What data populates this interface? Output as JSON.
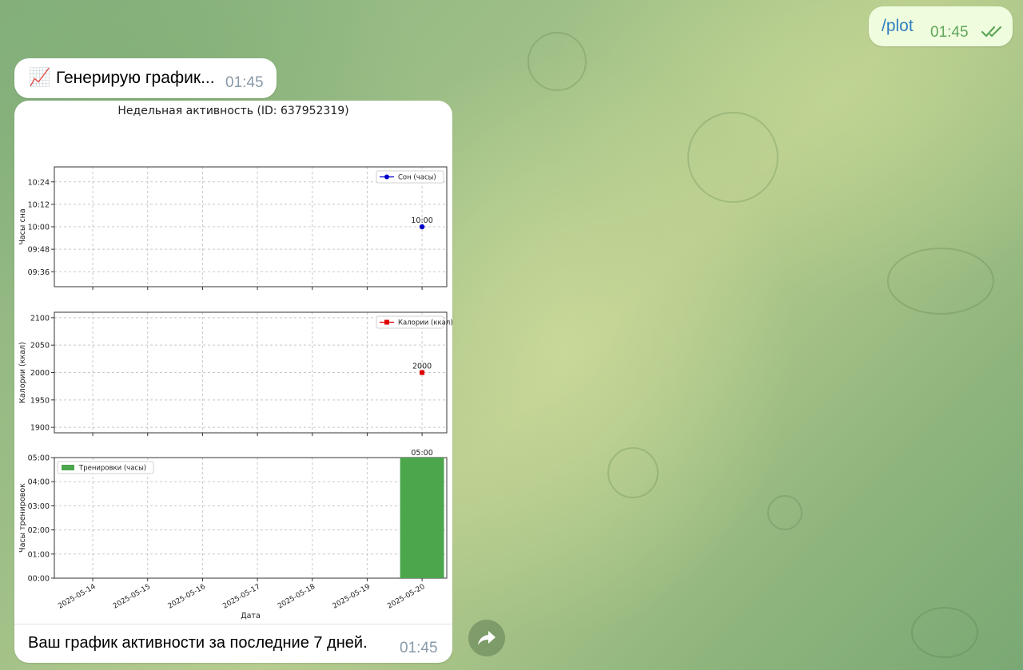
{
  "outgoing": {
    "text": "/plot",
    "time": "01:45",
    "status_icon": "double-check-icon"
  },
  "incoming_status": {
    "emoji": "📈",
    "text": "Генерирую график...",
    "time": "01:45"
  },
  "figure": {
    "title": "Недельная активность (ID: 637952319)"
  },
  "caption": {
    "text": "Ваш график активности за последние 7 дней.",
    "time": "01:45"
  },
  "chart_data": [
    {
      "type": "line",
      "title": "",
      "ylabel": "Часы сна",
      "y_ticks": [
        "09:36",
        "09:48",
        "10:00",
        "10:12",
        "10:24"
      ],
      "ylim": [
        "09:28",
        "10:32"
      ],
      "grid": true,
      "legend": "top-right",
      "series": [
        {
          "name": "Сон (часы)",
          "color": "#0000cc",
          "marker": "circle",
          "points": [
            {
              "x": "2025-05-20",
              "y": "10:00",
              "label": "10:00"
            }
          ]
        }
      ]
    },
    {
      "type": "line",
      "title": "",
      "ylabel": "Калории (ккал)",
      "y_ticks": [
        1900,
        1950,
        2000,
        2050,
        2100
      ],
      "ylim": [
        1890,
        2110
      ],
      "grid": true,
      "legend": "top-right",
      "series": [
        {
          "name": "Калории (ккал)",
          "color": "#dd0000",
          "marker": "square",
          "points": [
            {
              "x": "2025-05-20",
              "y": 2000,
              "label": "2000"
            }
          ]
        }
      ]
    },
    {
      "type": "bar",
      "title": "",
      "xlabel": "Дата",
      "ylabel": "Часы тренировок",
      "x_ticks": [
        "2025-05-14",
        "2025-05-15",
        "2025-05-16",
        "2025-05-17",
        "2025-05-18",
        "2025-05-19",
        "2025-05-20"
      ],
      "y_ticks": [
        "00:00",
        "01:00",
        "02:00",
        "03:00",
        "04:00",
        "05:00"
      ],
      "ylim": [
        "00:00",
        "05:00"
      ],
      "grid": true,
      "legend": "top-left",
      "series": [
        {
          "name": "Тренировки (часы)",
          "color": "#4ca64c",
          "points": [
            {
              "x": "2025-05-20",
              "y": "05:00",
              "label": "05:00"
            }
          ]
        }
      ]
    }
  ]
}
